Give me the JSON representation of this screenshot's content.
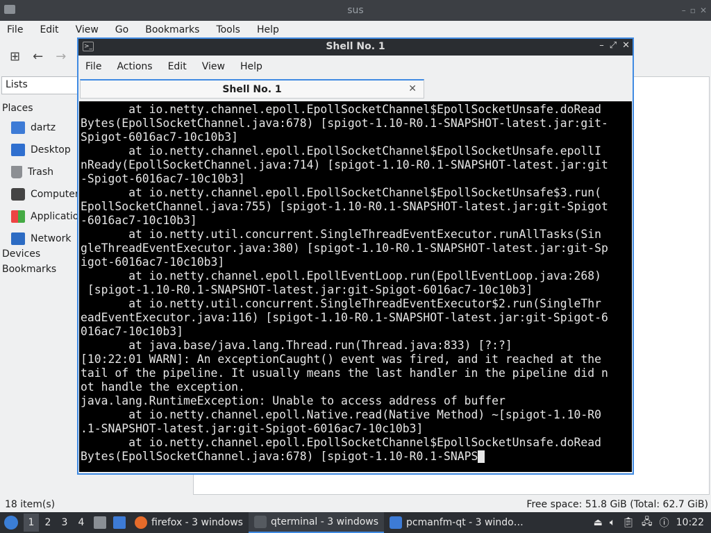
{
  "bg_window": {
    "title": "sus",
    "menu": [
      "File",
      "Edit",
      "View",
      "Go",
      "Bookmarks",
      "Tools",
      "Help"
    ],
    "lists_label": "Lists",
    "places_header": "Places",
    "places": [
      {
        "label": "dartz",
        "icon": "folder-icon"
      },
      {
        "label": "Desktop",
        "icon": "desktop-icon"
      },
      {
        "label": "Trash",
        "icon": "trash-icon"
      },
      {
        "label": "Computer",
        "icon": "computer-icon"
      },
      {
        "label": "Applications",
        "icon": "applications-icon"
      },
      {
        "label": "Network",
        "icon": "network-icon"
      }
    ],
    "devices_header": "Devices",
    "bookmarks_header": "Bookmarks",
    "status_left": "18 item(s)",
    "status_right": "Free space: 51.8 GiB (Total: 62.7 GiB)"
  },
  "terminal": {
    "title": "Shell No. 1",
    "menu": [
      "File",
      "Actions",
      "Edit",
      "View",
      "Help"
    ],
    "tab_label": "Shell No. 1",
    "lines": [
      "       at io.netty.channel.epoll.EpollSocketChannel$EpollSocketUnsafe.doRead",
      "Bytes(EpollSocketChannel.java:678) [spigot-1.10-R0.1-SNAPSHOT-latest.jar:git-",
      "Spigot-6016ac7-10c10b3]",
      "       at io.netty.channel.epoll.EpollSocketChannel$EpollSocketUnsafe.epollI",
      "nReady(EpollSocketChannel.java:714) [spigot-1.10-R0.1-SNAPSHOT-latest.jar:git",
      "-Spigot-6016ac7-10c10b3]",
      "       at io.netty.channel.epoll.EpollSocketChannel$EpollSocketUnsafe$3.run(",
      "EpollSocketChannel.java:755) [spigot-1.10-R0.1-SNAPSHOT-latest.jar:git-Spigot",
      "-6016ac7-10c10b3]",
      "       at io.netty.util.concurrent.SingleThreadEventExecutor.runAllTasks(Sin",
      "gleThreadEventExecutor.java:380) [spigot-1.10-R0.1-SNAPSHOT-latest.jar:git-Sp",
      "igot-6016ac7-10c10b3]",
      "       at io.netty.channel.epoll.EpollEventLoop.run(EpollEventLoop.java:268)",
      " [spigot-1.10-R0.1-SNAPSHOT-latest.jar:git-Spigot-6016ac7-10c10b3]",
      "       at io.netty.util.concurrent.SingleThreadEventExecutor$2.run(SingleThr",
      "eadEventExecutor.java:116) [spigot-1.10-R0.1-SNAPSHOT-latest.jar:git-Spigot-6",
      "016ac7-10c10b3]",
      "       at java.base/java.lang.Thread.run(Thread.java:833) [?:?]",
      "[10:22:01 WARN]: An exceptionCaught() event was fired, and it reached at the",
      "tail of the pipeline. It usually means the last handler in the pipeline did n",
      "ot handle the exception.",
      "java.lang.RuntimeException: Unable to access address of buffer",
      "       at io.netty.channel.epoll.Native.read(Native Method) ~[spigot-1.10-R0",
      ".1-SNAPSHOT-latest.jar:git-Spigot-6016ac7-10c10b3]",
      "       at io.netty.channel.epoll.EpollSocketChannel$EpollSocketUnsafe.doRead",
      "Bytes(EpollSocketChannel.java:678) [spigot-1.10-R0.1-SNAPS"
    ]
  },
  "taskbar": {
    "workspaces": [
      "1",
      "2",
      "3",
      "4"
    ],
    "tasks": [
      {
        "label": "firefox - 3 windows",
        "icon": "firefox-icon",
        "color": "#e66b2a"
      },
      {
        "label": "qterminal - 3 windows",
        "icon": "terminal-icon",
        "color": "#555a60"
      },
      {
        "label": "pcmanfm-qt - 3 windo…",
        "icon": "folder-icon",
        "color": "#3d7bd6"
      }
    ],
    "clock": "10:22"
  },
  "colors": {
    "accent": "#3f8ae2",
    "terminal_bg": "#000000",
    "terminal_fg": "#e6e6e6"
  }
}
